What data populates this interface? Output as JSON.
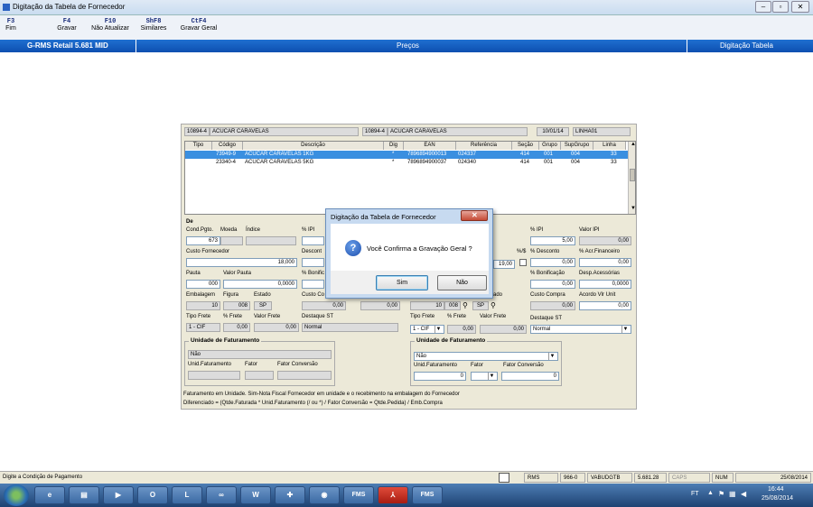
{
  "window": {
    "title": "Digitação da Tabela de Fornecedor"
  },
  "fkeys": [
    {
      "key": "F3",
      "label": "Fim"
    },
    {
      "key": "F4",
      "label": "Gravar"
    },
    {
      "key": "F10",
      "label": "Não Atualizar"
    },
    {
      "key": "ShF8",
      "label": "Similares"
    },
    {
      "key": "CtF4",
      "label": "Gravar Geral"
    }
  ],
  "bluebar": {
    "left": "G-RMS Retail 5.681 MID",
    "center": "Preços",
    "right": "Digitação Tabela"
  },
  "header": {
    "code1": "10894-4",
    "name1": "ACUCAR CARAVELAS",
    "code2": "10894-4",
    "name2": "ACUCAR CARAVELAS",
    "date": "10/01/14",
    "linha": "LINHA01"
  },
  "grid": {
    "columns": [
      "Tipo",
      "Código",
      "Descrição",
      "Dig",
      "EAN",
      "Referência",
      "Seção",
      "Grupo",
      "SupGrupo",
      "Linha"
    ],
    "rows": [
      {
        "tipo": "",
        "codigo": "73949-9",
        "descricao": "ACUCAR CARAVELAS 1KG",
        "dig": "*",
        "ean": "7896894900013",
        "ref": "024337",
        "secao": "414",
        "grupo": "001",
        "supgrupo": "004",
        "linha": "33"
      },
      {
        "tipo": "",
        "codigo": "23340-4",
        "descricao": "ACUCAR CARAVELAS 5KG",
        "dig": "*",
        "ean": "7896894900037",
        "ref": "024340",
        "secao": "414",
        "grupo": "001",
        "supgrupo": "004",
        "linha": "33"
      }
    ]
  },
  "left": {
    "de": "De",
    "cond_label": "Cond.Pgto.",
    "moeda_label": "Moeda",
    "indice_label": "Índice",
    "ipi_label": "% IPI",
    "cond_value": "673",
    "custo_fornecedor_label": "Custo Fornecedor",
    "custo_fornecedor_value": "18,000",
    "desconto_label": "Descont",
    "pauta_label": "Pauta",
    "valor_pauta_label": "Valor Pauta",
    "bonif_label": "% Bonific",
    "pauta_value": "000",
    "valor_pauta_value": "0,0000",
    "embalagem_label": "Embalagem",
    "figura_label": "Figura",
    "estado_label": "Estado",
    "custo_compra_label": "Custo Co",
    "embalagem_value": "10",
    "figura_value": "008",
    "estado_value": "SP",
    "custo_value1": "0,00",
    "custo_value2": "0,00",
    "tipo_frete_label": "Tipo Frete",
    "perc_frete_label": "% Frete",
    "valor_frete_label": "Valor Frete",
    "destaque_label": "Destaque ST",
    "tipo_frete_value": "1 - CIF",
    "perc_frete_value": "0,00",
    "valor_frete_value": "0,00",
    "destaque_value": "Normal",
    "unidade_title": "Unidade de Faturamento",
    "unidade_value": "Não",
    "unid_fat_label": "Unid.Faturamento",
    "fator_label": "Fator",
    "fator_conv_label": "Fator Conversão"
  },
  "right": {
    "ipi_label": "% IPI",
    "valor_ipi_label": "Valor IPI",
    "ipi_value": "5,00",
    "valor_ipi_value": "0,00",
    "pct_label": "%/$",
    "desconto_label": "% Desconto",
    "acr_label": "% Acr.Financeiro",
    "left_value": "19,00",
    "desconto_value": "0,00",
    "acr_value": "0,00",
    "bonif_label": "% Bonificação",
    "desp_label": "Desp.Acessórias",
    "bonif_value": "0,00",
    "desp_value": "0,0000",
    "estado_label": "ado",
    "custo_compra_label": "Custo Compra",
    "acordo_label": "Acordo Vlr Unit",
    "embalagem_value": "10",
    "figura_value": "008",
    "estado_value": "SP",
    "custo_compra_value": "0,00",
    "acordo_value": "0,00",
    "tipo_frete_label": "Tipo Frete",
    "perc_frete_label": "% Frete",
    "valor_frete_label": "Valor Frete",
    "destaque_label": "Destaque ST",
    "tipo_frete_value": "1 - CIF",
    "perc_frete_value": "0,00",
    "valor_frete_value": "0,00",
    "destaque_value": "Normal",
    "unidade_title": "Unidade de Faturamento",
    "unidade_value": "Não",
    "unid_fat_label": "Unid.Faturamento",
    "fator_label": "Fator",
    "fator_conv_label": "Fator Conversão",
    "unid_value": "0",
    "fator_conv_value": "0"
  },
  "notes": {
    "line1": "Faturamento em Unidade. Sim-Nota Fiscal Fornecedor em unidade e o recebimento na embalagem do Fornecedor",
    "line2": "Diferenciado = (Qtde.Faturada * Unid.Faturamento (/ ou *) / Fator Conversão  = Qtde.Pedida) / Emb.Compra"
  },
  "dialog": {
    "title": "Digitação da Tabela de Fornecedor",
    "message": "Você Confirma a Gravação Geral ?",
    "yes": "Sim",
    "no": "Não"
  },
  "statusbar": {
    "message": "Digite a Condição de Pagamento",
    "app": "RMS",
    "code": "966-0",
    "user": "VABUDGTB",
    "version": "5.681.28",
    "caps": "CAPS",
    "num": "NUM",
    "date": "25/08/2014"
  },
  "taskbar": {
    "lang": "FT",
    "time": "16:44",
    "date": "25/08/2014",
    "fms": "FMS"
  }
}
